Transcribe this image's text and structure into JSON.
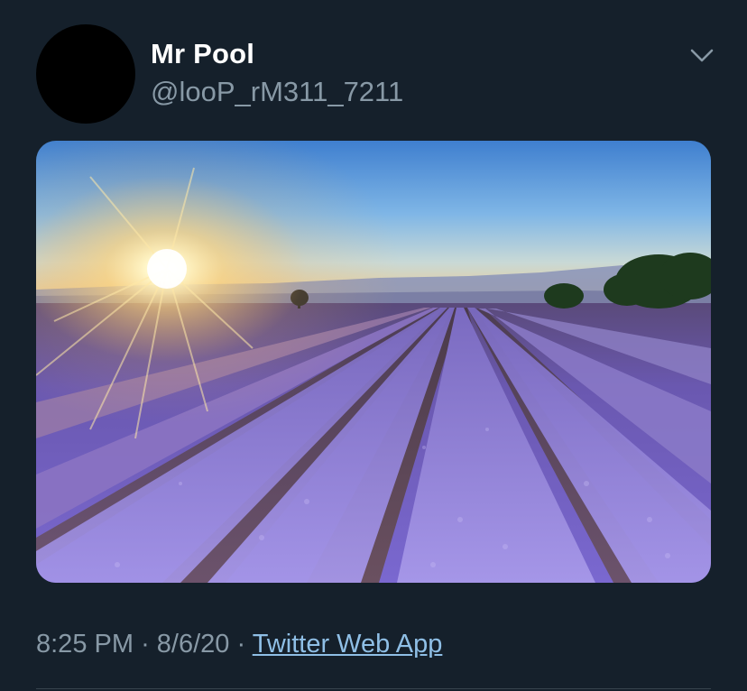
{
  "tweet": {
    "display_name": "Mr Pool",
    "handle": "@looP_rM311_7211",
    "time": "8:25 PM",
    "separator1": "·",
    "date": "8/6/20",
    "separator2": "·",
    "source": "Twitter Web App"
  },
  "media": {
    "description_icon": "photo",
    "scene": "lavender-field-sunset"
  },
  "colors": {
    "background": "#15202b",
    "secondary_text": "#8899a6",
    "link": "#8fbfe6"
  }
}
